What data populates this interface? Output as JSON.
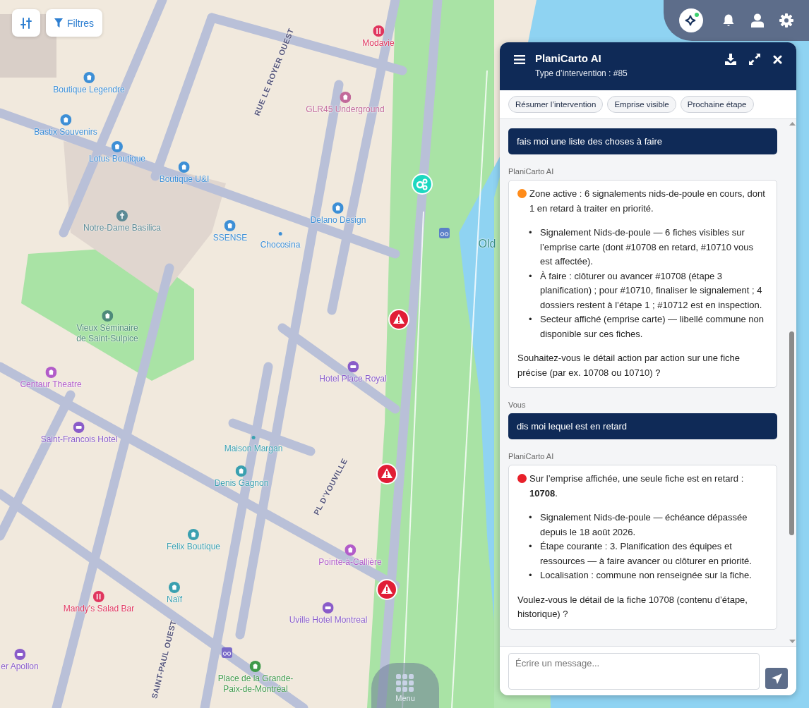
{
  "map_controls": {
    "filters_label": "Filtres"
  },
  "top_bar": {
    "assistant_active": true
  },
  "map": {
    "pois": [
      {
        "label": "Modavie",
        "kind": "restaurant",
        "color": "#e0365e"
      },
      {
        "label": "Boutique Legendre",
        "kind": "shop",
        "color": "#3d8fd6"
      },
      {
        "label": "GLR45 Underground",
        "kind": "gallery",
        "color": "#c2699a"
      },
      {
        "label": "Bastix Souvenirs",
        "kind": "shop",
        "color": "#3d8fd6"
      },
      {
        "label": "Lotus Boutique",
        "kind": "clothing",
        "color": "#3d8fd6"
      },
      {
        "label": "Boutique U&I",
        "kind": "clothing",
        "color": "#3d8fd6"
      },
      {
        "label": "Delano Design",
        "kind": "clothing",
        "color": "#3d8fd6"
      },
      {
        "label": "Notre-Dame Basilica",
        "kind": "church",
        "color": "#5b8a95"
      },
      {
        "label": "SSENSE",
        "kind": "clothing",
        "color": "#3d8fd6"
      },
      {
        "label": "Chocosina",
        "kind": "dot",
        "color": "#3d8fd6"
      },
      {
        "label": "Old",
        "kind": "none",
        "color": "#3a8f86"
      },
      {
        "label": "Vieux Séminaire\nde Saint-Sulpice",
        "kind": "garden",
        "color": "#4e8a7a"
      },
      {
        "label": "Hotel Place Royal",
        "kind": "hotel",
        "color": "#8a5cc9"
      },
      {
        "label": "Centaur Theatre",
        "kind": "theatre",
        "color": "#b25cc9"
      },
      {
        "label": "Saint-Francois Hotel",
        "kind": "hotel",
        "color": "#8a5cc9"
      },
      {
        "label": "Maison Margan",
        "kind": "dot",
        "color": "#3aa0b0"
      },
      {
        "label": "Denis Gagnon",
        "kind": "clothing",
        "color": "#3aa0b0"
      },
      {
        "label": "Felix Boutique",
        "kind": "shoe",
        "color": "#3aa0b0"
      },
      {
        "label": "Pointe-à-Callière",
        "kind": "museum",
        "color": "#b25cc9"
      },
      {
        "label": "Naïf",
        "kind": "clothing",
        "color": "#3aa0b0"
      },
      {
        "label": "Mandy's Salad Bar",
        "kind": "restaurant",
        "color": "#e0365e"
      },
      {
        "label": "Uville Hotel Montreal",
        "kind": "hotel",
        "color": "#8a5cc9"
      },
      {
        "label": "er Apollon",
        "kind": "hotel",
        "color": "#8a5cc9"
      },
      {
        "label": "Place de la Grande-\nPaix-de-Montréal",
        "kind": "park",
        "color": "#3f9a4a"
      }
    ],
    "streets": [
      "RUE LE ROYER OUEST",
      "PL D'YOUVILLE",
      "SAINT-PAUL OUEST"
    ]
  },
  "chat": {
    "title": "PlaniCarto AI",
    "subtitle": "Type d’intervention : #85",
    "suggestions": [
      "Résumer l’intervention",
      "Emprise visible",
      "Prochaine étape"
    ],
    "messages": [
      {
        "kind": "user",
        "text": "fais moi une liste des choses à faire"
      },
      {
        "kind": "assistant",
        "sender": "PlaniCarto AI",
        "color": "#ff8c1a",
        "intro": "Zone active : 6 signalements nids-de-poule en cours, dont 1 en retard à traiter en priorité.",
        "bullet": "•",
        "bullets": [
          "Signalement Nids-de-poule — 6 fiches visibles sur l’emprise carte (dont #10708 en retard, #10710 vous est affectée).",
          "À faire : clôturer ou avancer #10708 (étape 3 planification) ; pour #10710, finaliser le signalement ; 4 dossiers restent à l’étape 1 ; #10712 est en inspection.",
          "Secteur affiché (emprise carte) — libellé commune non disponible sur ces fiches."
        ],
        "closing": "Souhaitez-vous le détail action par action sur une fiche précise (par ex. 10708 ou 10710) ?"
      },
      {
        "kind": "user",
        "sender": "Vous",
        "text": "dis moi lequel est en retard"
      },
      {
        "kind": "assistant",
        "sender": "PlaniCarto AI",
        "color": "#e8202a",
        "intro": "Sur l’emprise affichée, une seule fiche est en retard : **10708**.",
        "bullet": "•",
        "bullets": [
          "Signalement Nids-de-poule — échéance dépassée depuis le 18 août 2026.",
          "Étape courante : 3. Planification des équipes et ressources — à faire avancer ou clôturer en priorité.",
          "Localisation : commune non renseignée sur la fiche."
        ],
        "closing": "Voulez-vous le détail de la fiche 10708 (contenu d’étape, historique) ?"
      }
    ],
    "input": {
      "placeholder": "Écrire un message..."
    }
  },
  "menu": {
    "label": "Menu"
  }
}
